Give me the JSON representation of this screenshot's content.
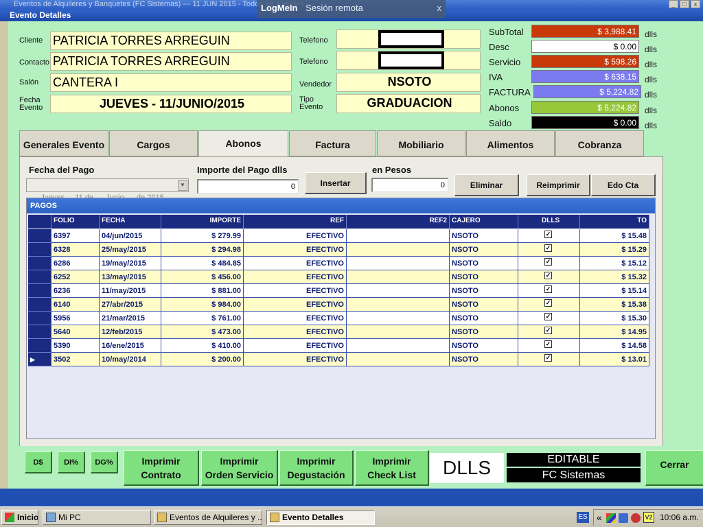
{
  "background_window": {
    "title": "Eventos de Alquileres y Banquetes   (FC Sistemas)   --- 11 JUN 2015 - Todos los Eventos ---",
    "controls": [
      "_",
      "□",
      "x"
    ]
  },
  "logmein": {
    "brand": "LogMeIn",
    "session": "Sesión remota",
    "close": "x"
  },
  "window": {
    "title": "Evento Detalles"
  },
  "header": {
    "cliente_label": "Cliente",
    "cliente": "PATRICIA TORRES ARREGUIN",
    "contacto_label": "Contacto",
    "contacto": "PATRICIA TORRES ARREGUIN",
    "salon_label": "Salón",
    "salon": "CANTERA I",
    "fecha_label": "Fecha Evento",
    "fecha": "JUEVES  -  11/JUNIO/2015",
    "telefono_label": "Telefono",
    "telefono2_label": "Telefono",
    "vendedor_label": "Vendedor",
    "vendedor": "NSOTO",
    "tipo_label": "Tipo Evento",
    "tipo": "GRADUACION"
  },
  "totals": {
    "unit": "dlls",
    "items": [
      {
        "label": "SubTotal",
        "value": "$ 3,988.41",
        "color": "#c83a0a"
      },
      {
        "label": "Desc",
        "value": "$ 0.00",
        "color": "#ffffff"
      },
      {
        "label": "Servicio",
        "value": "$ 598.26",
        "color": "#c83a0a"
      },
      {
        "label": "IVA",
        "value": "$ 638.15",
        "color": "#7b7bef"
      },
      {
        "label": "FACTURA",
        "value": "$ 5,224.82",
        "color": "#7b7bef"
      },
      {
        "label": "Abonos",
        "value": "$ 5,224.82",
        "color": "#96c83a"
      },
      {
        "label": "Saldo",
        "value": "$ 0.00",
        "color": "#000000"
      }
    ]
  },
  "tabs": [
    "Generales Evento",
    "Cargos",
    "Abonos",
    "Factura",
    "Mobiliario",
    "Alimentos",
    "Cobranza"
  ],
  "active_tab": "Abonos",
  "abonos": {
    "fecha_label": "Fecha del Pago",
    "fecha_value": "Jueves   , 11 de      Junio      de 2015",
    "importe_label": "Importe del Pago dlls",
    "importe_value": "0",
    "insertar": "Insertar",
    "pesos_label": "en Pesos",
    "pesos_value": "0",
    "eliminar": "Eliminar",
    "reimprimir": "Reimprimir",
    "edo_cta": "Edo Cta"
  },
  "grid": {
    "title": "PAGOS",
    "columns": [
      "FOLIO",
      "FECHA",
      "IMPORTE",
      "REF",
      "REF2",
      "CAJERO",
      "DLLS",
      "TO"
    ],
    "rows": [
      {
        "folio": "6397",
        "fecha": "04/jun/2015",
        "importe": "$ 279.99",
        "ref": "EFECTIVO",
        "ref2": "",
        "cajero": "NSOTO",
        "dlls": "✓",
        "to": "$ 15.48"
      },
      {
        "folio": "6328",
        "fecha": "25/may/2015",
        "importe": "$ 294.98",
        "ref": "EFECTIVO",
        "ref2": "",
        "cajero": "NSOTO",
        "dlls": "✓",
        "to": "$ 15.29"
      },
      {
        "folio": "6286",
        "fecha": "19/may/2015",
        "importe": "$ 484.85",
        "ref": "EFECTIVO",
        "ref2": "",
        "cajero": "NSOTO",
        "dlls": "✓",
        "to": "$ 15.12"
      },
      {
        "folio": "6252",
        "fecha": "13/may/2015",
        "importe": "$ 456.00",
        "ref": "EFECTIVO",
        "ref2": "",
        "cajero": "NSOTO",
        "dlls": "✓",
        "to": "$ 15.32"
      },
      {
        "folio": "6236",
        "fecha": "11/may/2015",
        "importe": "$ 881.00",
        "ref": "EFECTIVO",
        "ref2": "",
        "cajero": "NSOTO",
        "dlls": "✓",
        "to": "$ 15.14"
      },
      {
        "folio": "6140",
        "fecha": "27/abr/2015",
        "importe": "$ 984.00",
        "ref": "EFECTIVO",
        "ref2": "",
        "cajero": "NSOTO",
        "dlls": "✓",
        "to": "$ 15.38"
      },
      {
        "folio": "5956",
        "fecha": "21/mar/2015",
        "importe": "$ 761.00",
        "ref": "EFECTIVO",
        "ref2": "",
        "cajero": "NSOTO",
        "dlls": "✓",
        "to": "$ 15.30"
      },
      {
        "folio": "5640",
        "fecha": "12/feb/2015",
        "importe": "$ 473.00",
        "ref": "EFECTIVO",
        "ref2": "",
        "cajero": "NSOTO",
        "dlls": "✓",
        "to": "$ 14.95"
      },
      {
        "folio": "5390",
        "fecha": "16/ene/2015",
        "importe": "$ 410.00",
        "ref": "EFECTIVO",
        "ref2": "",
        "cajero": "NSOTO",
        "dlls": "✓",
        "to": "$ 14.58"
      },
      {
        "folio": "3502",
        "fecha": "10/may/2014",
        "importe": "$ 200.00",
        "ref": "EFECTIVO",
        "ref2": "",
        "cajero": "NSOTO",
        "dlls": "✓",
        "to": "$ 13.01"
      }
    ]
  },
  "bottom": {
    "d_btn": "D$",
    "di_btn": "DI%",
    "dg_btn": "DG%",
    "imprimir_contrato": [
      "Imprimir",
      "Contrato"
    ],
    "imprimir_orden": [
      "Imprimir",
      "Orden Servicio"
    ],
    "imprimir_degustacion": [
      "Imprimir",
      "Degustación"
    ],
    "imprimir_checklist": [
      "Imprimir",
      "Check List"
    ],
    "currency": "DLLS",
    "editable": "EDITABLE",
    "brand": "FC Sistemas",
    "cerrar": "Cerrar"
  },
  "taskbar": {
    "start": "Inicio",
    "items": [
      "Mi PC",
      "Eventos de Alquileres y ...",
      "Evento Detalles"
    ],
    "lang": "ES",
    "chevron": "«",
    "time": "10:06 a.m."
  }
}
